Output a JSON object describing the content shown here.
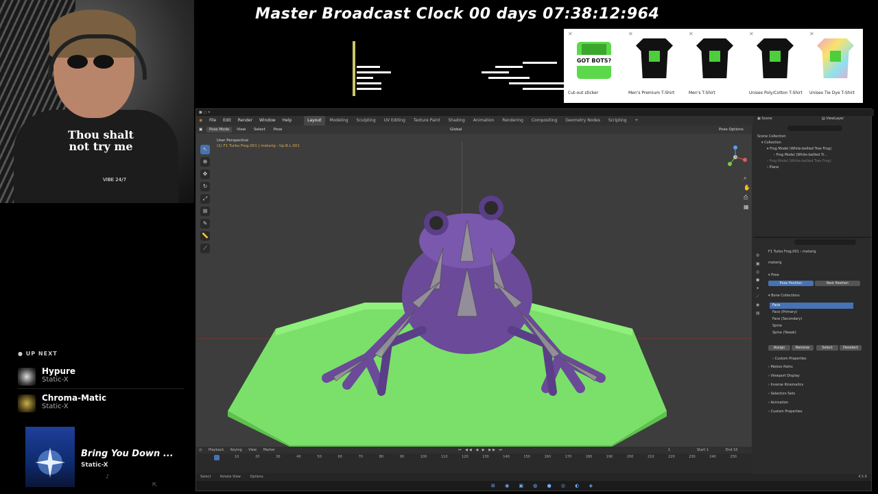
{
  "overlay": {
    "clock_label": "Master Broadcast Clock 00 days 07:38:12:964"
  },
  "webcam": {
    "shirt_text": "Thou shalt not try me",
    "shirt_sub": "VIBE 24/7"
  },
  "up_next": {
    "title": "UP NEXT",
    "tracks": [
      {
        "title": "Hypure",
        "artist": "Static-X"
      },
      {
        "title": "Chroma-Matic",
        "artist": "Static-X"
      }
    ],
    "now_playing": {
      "title": "Bring You Down ...",
      "artist": "Static-X"
    }
  },
  "merch": {
    "items": [
      {
        "label": "Cut-out sticker",
        "badge": "GOT BOTS?"
      },
      {
        "label": "Men's Premium T-Shirt"
      },
      {
        "label": "Men's T-Shirt"
      },
      {
        "label": "Unisex Poly/Cotton T-Shirt"
      },
      {
        "label": "Unisex Tie Dye T-Shirt"
      }
    ]
  },
  "blender": {
    "menu": [
      "File",
      "Edit",
      "Render",
      "Window",
      "Help"
    ],
    "workspaces": [
      "Layout",
      "Modeling",
      "Sculpting",
      "UV Editing",
      "Texture Paint",
      "Shading",
      "Animation",
      "Rendering",
      "Compositing",
      "Geometry Nodes",
      "Scripting"
    ],
    "active_workspace": "Layout",
    "viewport": {
      "mode": "Pose Mode",
      "header_menus": [
        "View",
        "Select",
        "Pose"
      ],
      "transform": "Global",
      "perspective": "User Perspective",
      "object_info": "(1) F1 Turbo Frog.001 | metarig : tip.B.L.001",
      "options": "Pose Options"
    },
    "outliner": {
      "search": "",
      "rows": [
        "Scene Collection",
        "Collection",
        "Frog Model (White-bellied Tree Frog)",
        "Frog Model (White-bellied Tr...",
        "Frog Model (White-bellied Tree Frog)",
        "Plane"
      ],
      "scene": "Scene",
      "view_layer": "ViewLayer"
    },
    "properties": {
      "breadcrumb_object": "F1 Turbo Frog.001",
      "breadcrumb_data": "metarig",
      "data_name": "metarig",
      "pose_section": "Pose",
      "pose_position": "Pose Position",
      "rest_position": "Rest Position",
      "bone_collections": "Bone Collections",
      "collections": [
        "Face",
        "Face (Primary)",
        "Face (Secondary)",
        "Spine",
        "Spine (Tweak)"
      ],
      "assign": "Assign",
      "remove": "Remove",
      "select": "Select",
      "deselect": "Deselect",
      "sections": [
        "Custom Properties",
        "Motion Paths",
        "Viewport Display",
        "Inverse Kinematics",
        "Selection Sets",
        "Animation",
        "Custom Properties"
      ]
    },
    "timeline": {
      "menus": [
        "Playback",
        "Keying",
        "View",
        "Marker"
      ],
      "current_frame": "1",
      "start_label": "Start",
      "start": "1",
      "end_label": "End",
      "end": "10",
      "ticks": [
        "1",
        "10",
        "20",
        "30",
        "40",
        "50",
        "60",
        "70",
        "80",
        "90",
        "100",
        "110",
        "120",
        "130",
        "140",
        "150",
        "160",
        "170",
        "180",
        "190",
        "200",
        "210",
        "220",
        "230",
        "240",
        "250"
      ]
    },
    "status": {
      "select": "Select",
      "rotate_view": "Rotate View",
      "options": "Options",
      "version": "4.5.6"
    }
  },
  "colors": {
    "accent": "#4772b3",
    "plate_green": "#7be06a",
    "frog_purple": "#6b4a9a",
    "merch_green": "#4ccf3a"
  }
}
